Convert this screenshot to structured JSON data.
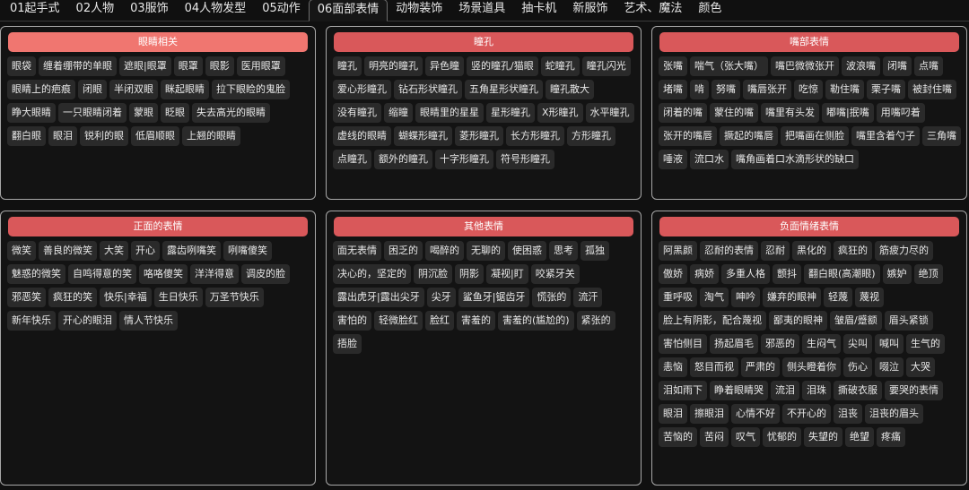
{
  "tabs": [
    {
      "label": "01起手式"
    },
    {
      "label": "02人物"
    },
    {
      "label": "03服饰"
    },
    {
      "label": "04人物发型"
    },
    {
      "label": "05动作"
    },
    {
      "label": "06面部表情",
      "active": true
    },
    {
      "label": "动物装饰"
    },
    {
      "label": "场景道具"
    },
    {
      "label": "抽卡机"
    },
    {
      "label": "新服饰"
    },
    {
      "label": "艺术、魔法"
    },
    {
      "label": "颜色"
    }
  ],
  "colors": {
    "header_light": "#f07670",
    "header": "#d9585a",
    "panel_bg": "#131313",
    "tag_bg": "#2a2a2a"
  },
  "panels": [
    {
      "name": "eyes",
      "title": "眼睛相关",
      "header_color": "#f07670",
      "tags": [
        "眼袋",
        "缠着绷带的单眼",
        "遮眼|眼罩",
        "眼罩",
        "眼影",
        "医用眼罩",
        "眼睛上的疤痕",
        "闭眼",
        "半闭双眼",
        "眯起眼睛",
        "拉下眼睑的鬼脸",
        "睁大眼睛",
        "一只眼睛闭着",
        "蒙眼",
        "眨眼",
        "失去高光的眼睛",
        "翻白眼",
        "眼泪",
        "锐利的眼",
        "低眉顺眼",
        "上翘的眼睛"
      ]
    },
    {
      "name": "pupils",
      "title": "瞳孔",
      "header_color": "#d9585a",
      "tags": [
        "瞳孔",
        "明亮的瞳孔",
        "异色瞳",
        "竖的瞳孔/猫眼",
        "蛇瞳孔",
        "瞳孔闪光",
        "爱心形瞳孔",
        "钻石形状瞳孔",
        "五角星形状瞳孔",
        "瞳孔散大",
        "没有瞳孔",
        "缩瞳",
        "眼睛里的星星",
        "星形瞳孔",
        "X形瞳孔",
        "水平瞳孔",
        "虚线的眼睛",
        "蝴蝶形瞳孔",
        "菱形瞳孔",
        "长方形瞳孔",
        "方形瞳孔",
        "点瞳孔",
        "额外的瞳孔",
        "十字形瞳孔",
        "符号形瞳孔"
      ]
    },
    {
      "name": "mouth",
      "title": "嘴部表情",
      "header_color": "#d9585a",
      "tags": [
        "张嘴",
        "喘气（张大嘴）",
        "嘴巴微微张开",
        "波浪嘴",
        "闭嘴",
        "点嘴",
        "堵嘴",
        "啃",
        "努嘴",
        "嘴唇张开",
        "吃惊",
        "勒住嘴",
        "栗子嘴",
        "被封住嘴",
        "闭着的嘴",
        "蒙住的嘴",
        "嘴里有头发",
        "嘟嘴|抿嘴",
        "用嘴叼着",
        "张开的嘴唇",
        "撅起的嘴唇",
        "把嘴画在侧脸",
        "嘴里含着勺子",
        "三角嘴",
        "唾液",
        "流口水",
        "嘴角画着口水滴形状的缺口"
      ]
    },
    {
      "name": "positive",
      "title": "正面的表情",
      "header_color": "#d9585a",
      "tags": [
        "微笑",
        "善良的微笑",
        "大笑",
        "开心",
        "露齿咧嘴笑",
        "咧嘴傻笑",
        "魅惑的微笑",
        "自鸣得意的笑",
        "咯咯傻笑",
        "洋洋得意",
        "调皮的脸",
        "邪恶笑",
        "疯狂的笑",
        "快乐|幸福",
        "生日快乐",
        "万圣节快乐",
        "新年快乐",
        "开心的眼泪",
        "情人节快乐"
      ]
    },
    {
      "name": "other",
      "title": "其他表情",
      "header_color": "#d9585a",
      "tags": [
        "面无表情",
        "困乏的",
        "喝醉的",
        "无聊的",
        "使困惑",
        "思考",
        "孤独",
        "决心的，坚定的",
        "阴沉脸",
        "阴影",
        "凝视|盯",
        "咬紧牙关",
        "露出虎牙|露出尖牙",
        "尖牙",
        "鲨鱼牙|锯齿牙",
        "慌张的",
        "流汗",
        "害怕的",
        "轻微脸红",
        "脸红",
        "害羞的",
        "害羞的(尴尬的)",
        "紧张的",
        "捂脸"
      ]
    },
    {
      "name": "negative",
      "title": "负面情绪表情",
      "header_color": "#d9585a",
      "tags": [
        "阿黑颜",
        "忍耐的表情",
        "忍耐",
        "黑化的",
        "疯狂的",
        "筋疲力尽的",
        "傲娇",
        "病娇",
        "多重人格",
        "颤抖",
        "翻白眼(高潮眼)",
        "嫉妒",
        "绝顶",
        "重呼吸",
        "淘气",
        "呻吟",
        "嫌弃的眼神",
        "轻蔑",
        "蔑视",
        "脸上有阴影，配合蔑视",
        "鄙夷的眼神",
        "皱眉/蹙额",
        "眉头紧锁",
        "害怕侧目",
        "扬起眉毛",
        "邪恶的",
        "生闷气",
        "尖叫",
        "喊叫",
        "生气的",
        "恚恼",
        "怒目而视",
        "严肃的",
        "侧头瞪着你",
        "伤心",
        "啜泣",
        "大哭",
        "泪如雨下",
        "睁着眼睛哭",
        "流泪",
        "泪珠",
        "撕破衣服",
        "要哭的表情",
        "眼泪",
        "擦眼泪",
        "心情不好",
        "不开心的",
        "沮丧",
        "沮丧的眉头",
        "苦恼的",
        "苦闷",
        "叹气",
        "忧郁的",
        "失望的",
        "绝望",
        "疼痛"
      ]
    }
  ]
}
